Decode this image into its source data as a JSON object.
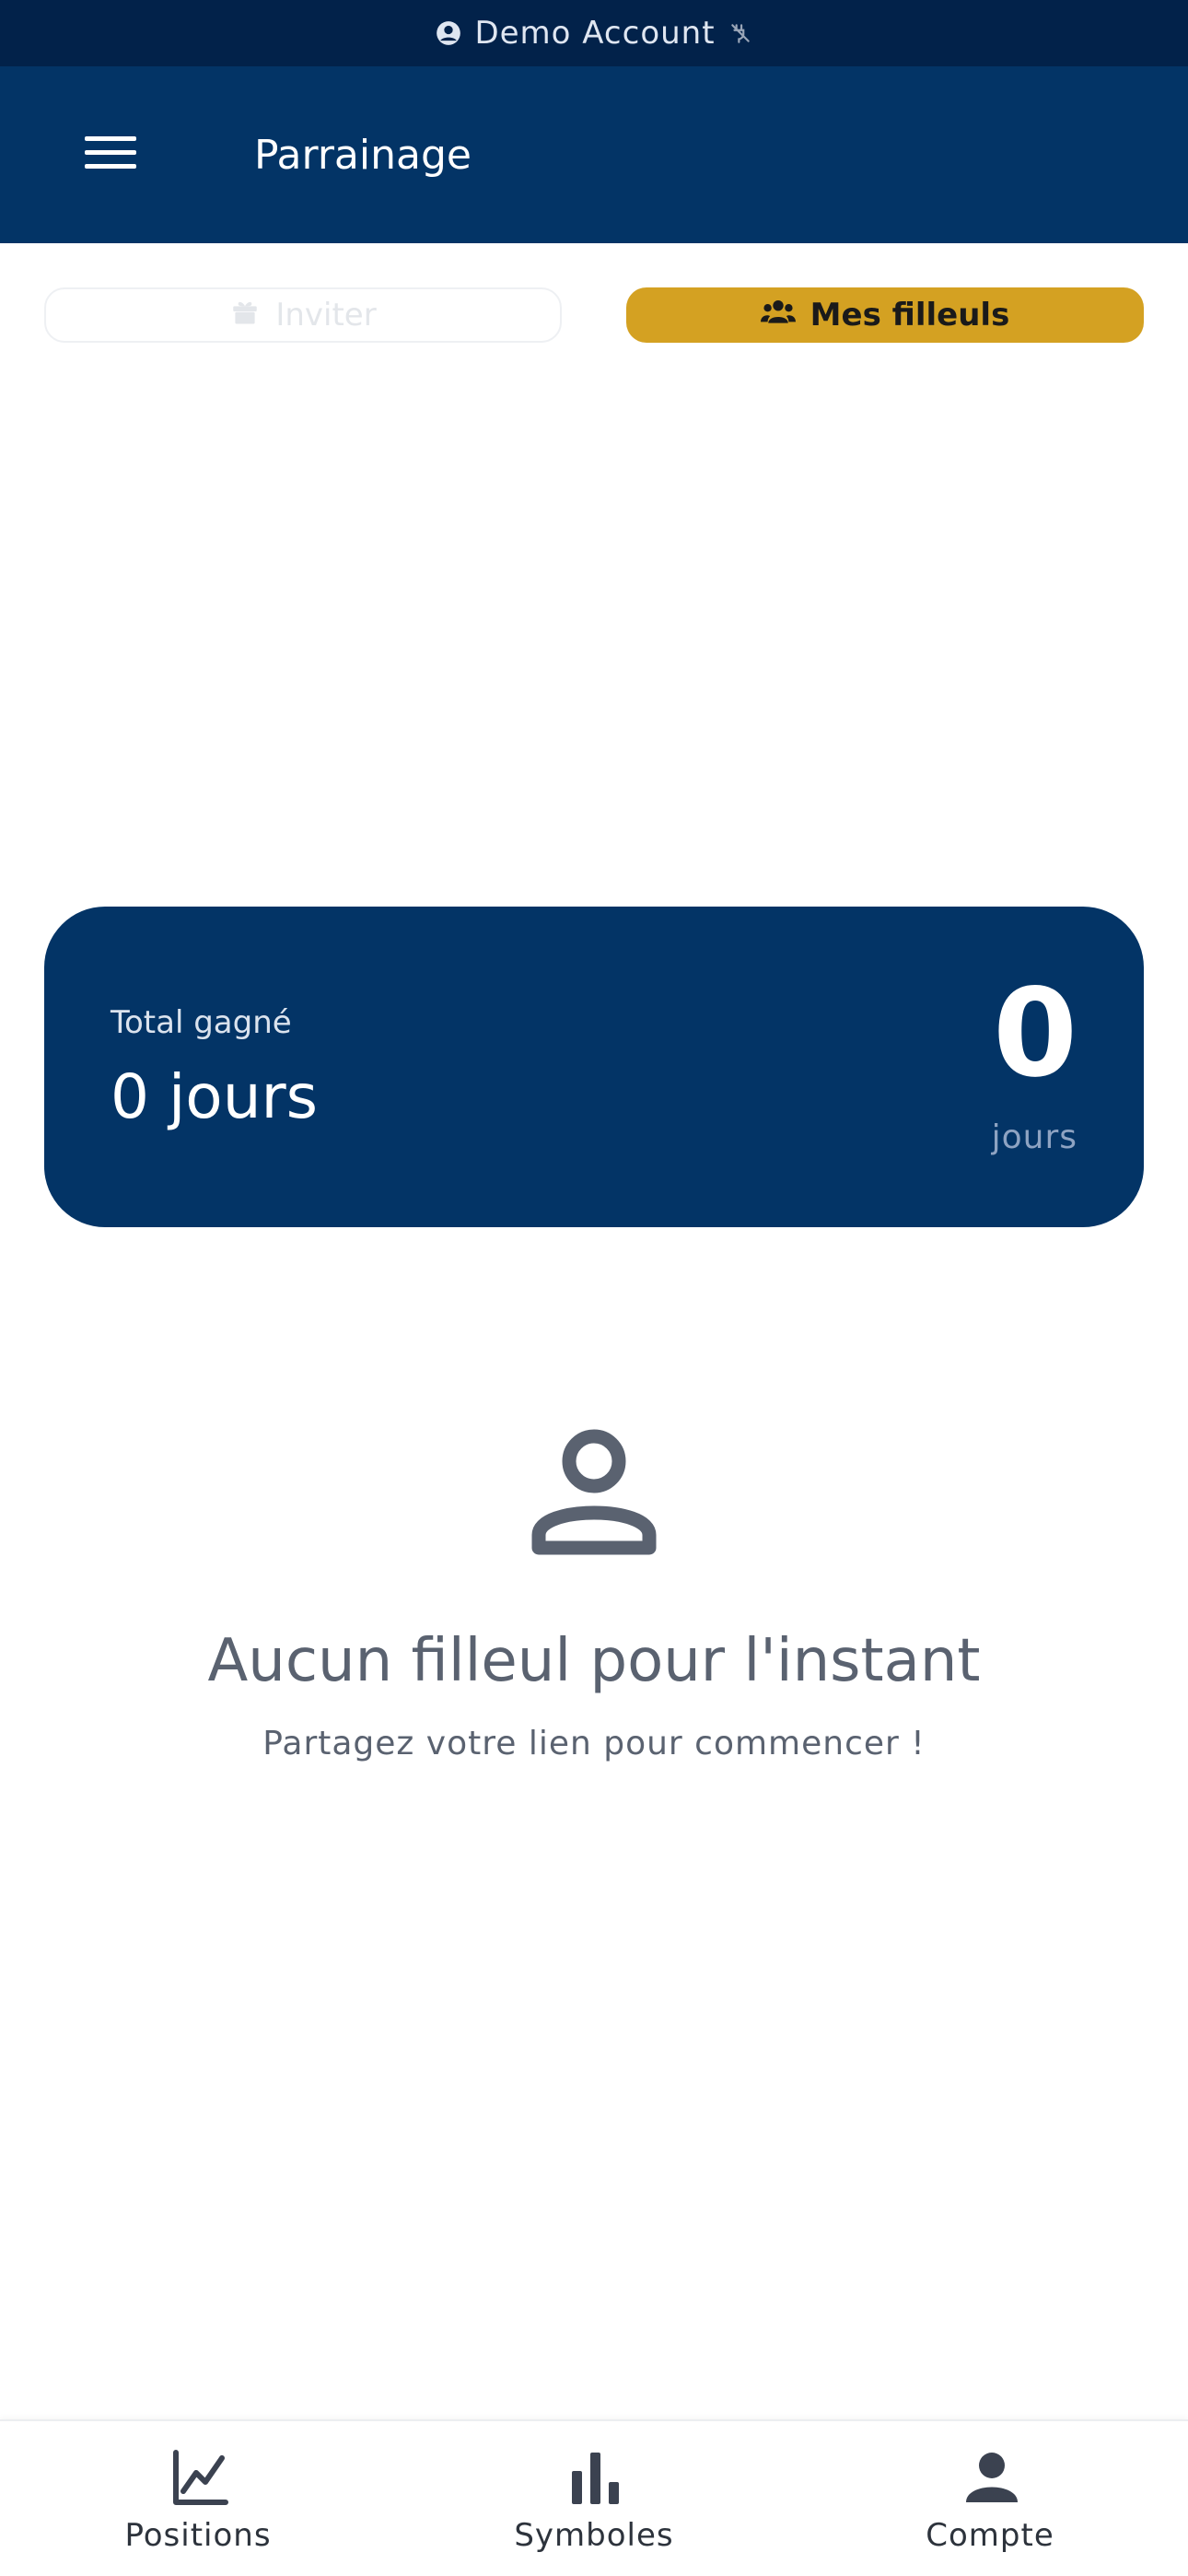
{
  "banner": {
    "label": "Demo Account",
    "account_icon": "account-circle-icon",
    "status_icon": "disconnected-icon"
  },
  "app_bar": {
    "title": "Parrainage",
    "menu_icon": "hamburger-menu-icon"
  },
  "tabs": [
    {
      "label": "Inviter",
      "icon": "gift-icon",
      "active": false
    },
    {
      "label": "Mes filleuls",
      "icon": "group-icon",
      "active": true
    }
  ],
  "total_card": {
    "label": "Total gagné",
    "value": "0 jours",
    "big_number": "0",
    "big_unit": "jours"
  },
  "empty_state": {
    "icon": "person-outline-icon",
    "title": "Aucun filleul pour l'instant",
    "subtitle": "Partagez votre lien pour commencer !"
  },
  "bottom_nav": [
    {
      "label": "Positions",
      "icon": "line-chart-icon"
    },
    {
      "label": "Symboles",
      "icon": "bar-chart-icon"
    },
    {
      "label": "Compte",
      "icon": "person-icon"
    }
  ],
  "colors": {
    "primary": "#033466",
    "banner": "#02224a",
    "accent": "#d4a122",
    "muted_text": "#5a6270"
  }
}
